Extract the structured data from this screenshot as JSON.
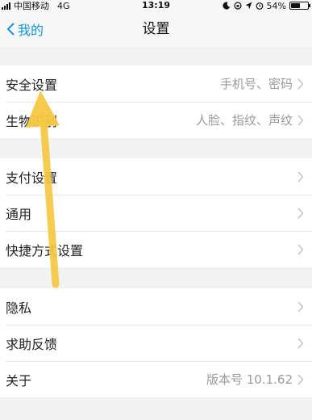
{
  "status_bar": {
    "carrier": "中国移动",
    "network": "4G",
    "time": "13:19",
    "battery_percent": "54%",
    "battery_level": 0.54
  },
  "nav": {
    "back_label": "我的",
    "title": "设置"
  },
  "groups": [
    {
      "items": [
        {
          "label": "安全设置",
          "value": "手机号、密码"
        },
        {
          "label": "生物识别",
          "value": "人脸、指纹、声纹"
        }
      ]
    },
    {
      "items": [
        {
          "label": "支付设置",
          "value": ""
        },
        {
          "label": "通用",
          "value": ""
        },
        {
          "label": "快捷方式设置",
          "value": ""
        }
      ]
    },
    {
      "items": [
        {
          "label": "隐私",
          "value": ""
        },
        {
          "label": "求助反馈",
          "value": ""
        },
        {
          "label": "关于",
          "value": "版本号 10.1.62"
        }
      ]
    }
  ],
  "colors": {
    "accent": "#1296db",
    "annotation_arrow": "#f5c842",
    "background": "#f2f2f2"
  },
  "icons": [
    "signal-icon",
    "moon-icon",
    "location-icon",
    "alarm-icon",
    "battery-icon",
    "back-chevron-icon",
    "chevron-right-icon",
    "annotation-arrow"
  ]
}
